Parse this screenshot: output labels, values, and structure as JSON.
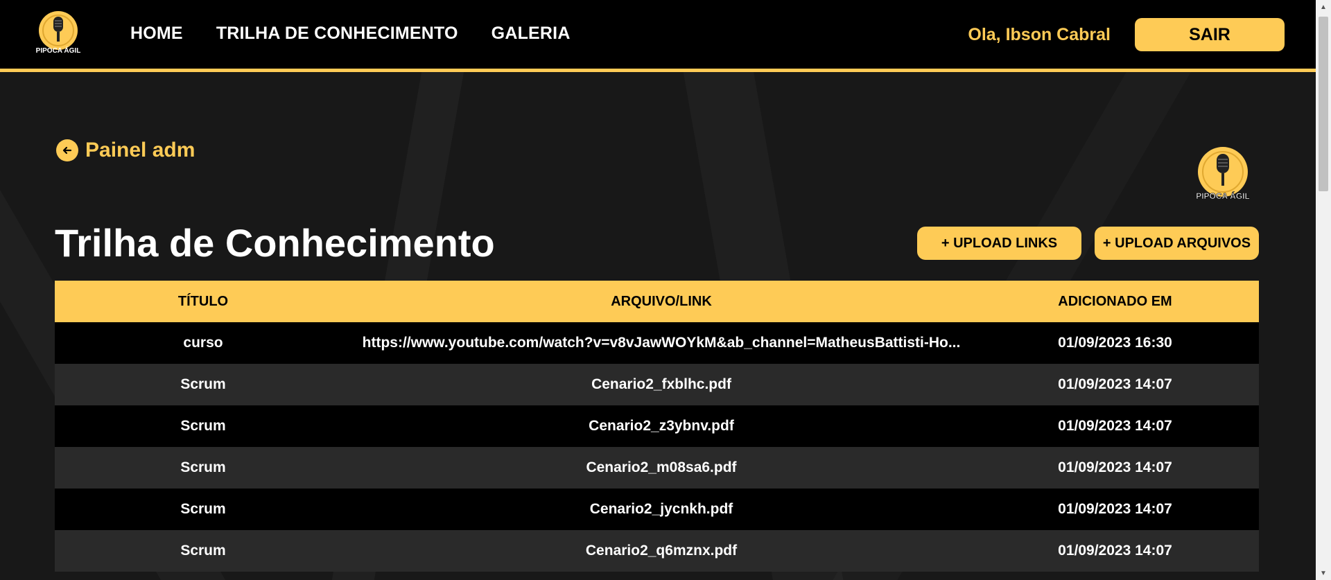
{
  "header": {
    "logo_text": "PIPOCA ÁGIL",
    "nav": [
      {
        "label": "HOME"
      },
      {
        "label": "TRILHA DE CONHECIMENTO"
      },
      {
        "label": "GALERIA"
      }
    ],
    "greeting": "Ola, Ibson Cabral",
    "logout_label": "SAIR"
  },
  "back_link": {
    "label": "Painel adm",
    "icon": "arrow-left-icon"
  },
  "page_title": "Trilha de Conhecimento",
  "actions": {
    "upload_links": "+ UPLOAD LINKS",
    "upload_files": "+ UPLOAD ARQUIVOS"
  },
  "table": {
    "headers": [
      "TÍTULO",
      "ARQUIVO/LINK",
      "ADICIONADO EM"
    ],
    "rows": [
      {
        "title": "curso",
        "file": "https://www.youtube.com/watch?v=v8vJawWOYkM&ab_channel=MatheusBattisti-Ho...",
        "date": "01/09/2023 16:30"
      },
      {
        "title": "Scrum",
        "file": "Cenario2_fxblhc.pdf",
        "date": "01/09/2023 14:07"
      },
      {
        "title": "Scrum",
        "file": "Cenario2_z3ybnv.pdf",
        "date": "01/09/2023 14:07"
      },
      {
        "title": "Scrum",
        "file": "Cenario2_m08sa6.pdf",
        "date": "01/09/2023 14:07"
      },
      {
        "title": "Scrum",
        "file": "Cenario2_jycnkh.pdf",
        "date": "01/09/2023 14:07"
      },
      {
        "title": "Scrum",
        "file": "Cenario2_q6mznx.pdf",
        "date": "01/09/2023 14:07"
      }
    ]
  },
  "colors": {
    "accent": "#fecb56",
    "header_bg": "#000000",
    "row_dark": "#000000",
    "row_alt": "#2a2a2a"
  }
}
